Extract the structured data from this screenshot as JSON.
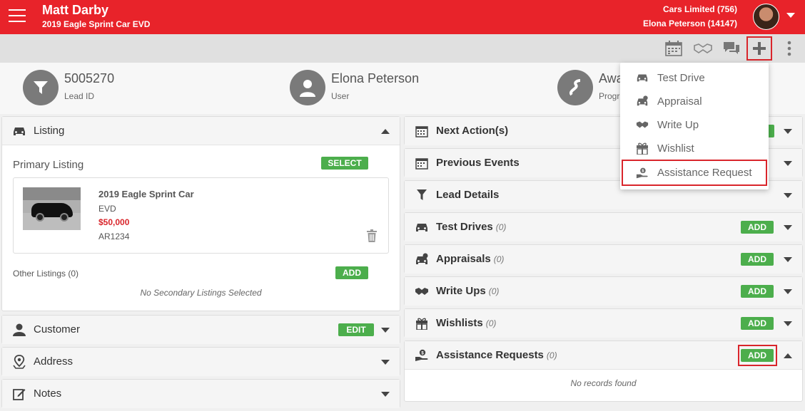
{
  "header": {
    "lead_name": "Matt Darby",
    "vehicle": "2019 Eagle Sprint Car EVD",
    "dealer": "Cars Limited (756)",
    "user": "Elona Peterson (14147)"
  },
  "info": {
    "lead_id_value": "5005270",
    "lead_id_label": "Lead ID",
    "user_value": "Elona Peterson",
    "user_label": "User",
    "progress_value": "Awa",
    "progress_label": "Progr"
  },
  "listing": {
    "title": "Listing",
    "primary_label": "Primary Listing",
    "select_label": "SELECT",
    "car_name": "2019 Eagle Sprint Car",
    "car_trim": "EVD",
    "car_price": "$50,000",
    "car_stock": "AR1234",
    "other_label": "Other Listings (0)",
    "add_label": "ADD",
    "empty_text": "No Secondary Listings Selected"
  },
  "left_panels": {
    "customer": "Customer",
    "customer_edit": "EDIT",
    "address": "Address",
    "notes": "Notes"
  },
  "right_panels": {
    "next_action": "Next Action(s)",
    "previous_events": "Previous Events",
    "lead_details": "Lead Details",
    "test_drives": "Test Drives",
    "test_drives_count": "(0)",
    "appraisals": "Appraisals",
    "appraisals_count": "(0)",
    "write_ups": "Write Ups",
    "write_ups_count": "(0)",
    "wishlists": "Wishlists",
    "wishlists_count": "(0)",
    "assistance": "Assistance Requests",
    "assistance_count": "(0)",
    "add_label": "ADD",
    "no_records": "No records found"
  },
  "menu": {
    "items": [
      "Test Drive",
      "Appraisal",
      "Write Up",
      "Wishlist",
      "Assistance Request"
    ]
  },
  "colors": {
    "brand": "#e8232a",
    "add_green": "#4cae4c",
    "price_red": "#d9252b"
  }
}
